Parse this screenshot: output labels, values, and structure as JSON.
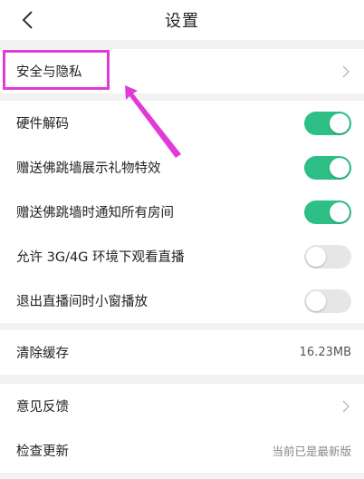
{
  "header": {
    "title": "设置",
    "back_icon": "chevron-left-icon"
  },
  "group1": {
    "privacy_label": "安全与隐私"
  },
  "toggles": [
    {
      "label": "硬件解码",
      "state": "on"
    },
    {
      "label": "赠送佛跳墙展示礼物特效",
      "state": "on"
    },
    {
      "label": "赠送佛跳墙时通知所有房间",
      "state": "on"
    },
    {
      "label": "允许 3G/4G 环境下观看直播",
      "state": "off"
    },
    {
      "label": "退出直播间时小窗播放",
      "state": "off"
    }
  ],
  "cache": {
    "label": "清除缓存",
    "value": "16.23MB"
  },
  "feedback": {
    "label": "意见反馈"
  },
  "update": {
    "label": "检查更新",
    "value": "当前已是最新版"
  },
  "colors": {
    "toggle_on": "#2dbf86",
    "toggle_off": "#e6e6e6",
    "annotation": "#e03bd7"
  }
}
